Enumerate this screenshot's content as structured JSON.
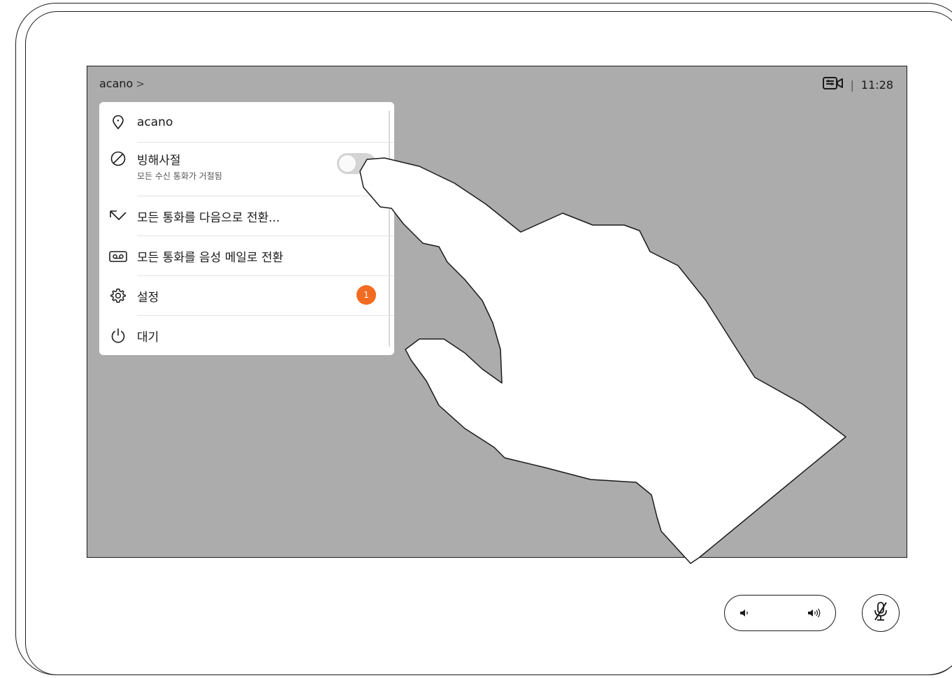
{
  "screen": {
    "title": "acano",
    "title_chevron": ">",
    "status_separator": "|",
    "clock": "11:28",
    "background_color": "#acacac"
  },
  "menu": {
    "items": [
      {
        "icon": "location-pin-icon",
        "label": "acano"
      },
      {
        "icon": "do-not-disturb-icon",
        "label": "빙해사절",
        "sublabel": "모든 수신 통화가 거절됨",
        "toggle_on": false
      },
      {
        "icon": "call-forward-icon",
        "label": "모든 통화를 다음으로 전환..."
      },
      {
        "icon": "voicemail-icon",
        "label": "모든 통화를 음성 메일로 전환"
      },
      {
        "icon": "gear-icon",
        "label": "설정",
        "badge": "1"
      },
      {
        "icon": "power-icon",
        "label": "대기"
      }
    ]
  },
  "colors": {
    "badge": "#f26b21",
    "screen": "#acacac",
    "outline": "#1a1a1a"
  },
  "controls": {
    "volume": {
      "down_icon": "volume-down-icon",
      "up_icon": "volume-up-icon"
    },
    "mute": {
      "icon": "microphone-muted-icon"
    }
  }
}
